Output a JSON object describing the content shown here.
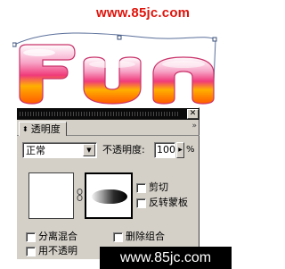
{
  "watermark": {
    "top_text": "www.85jc.com",
    "bottom_text": "www.85jc.com",
    "color": "#e0140c"
  },
  "artwork": {
    "text": "Fun",
    "gradient_colors": [
      "#ffffff",
      "#f7a6c8",
      "#f03a7a",
      "#ffb000",
      "#ff5a00"
    ]
  },
  "panel": {
    "close_label": "✕",
    "tab": {
      "icon": "up-down-triangle-icon",
      "label": "透明度"
    },
    "menu_label": "»",
    "blend_mode": {
      "value": "正常"
    },
    "opacity": {
      "label": "不透明度:",
      "value": "100",
      "unit": "%"
    },
    "checkboxes": {
      "clip": {
        "label": "剪切",
        "checked": false
      },
      "invert_mask": {
        "label": "反转蒙板",
        "checked": false
      },
      "knockout": {
        "label": "分离混合",
        "checked": false
      },
      "delete_group": {
        "label": "删除组合",
        "checked": false
      },
      "opacity_shape": {
        "label": "用不透明",
        "checked": false
      }
    }
  }
}
